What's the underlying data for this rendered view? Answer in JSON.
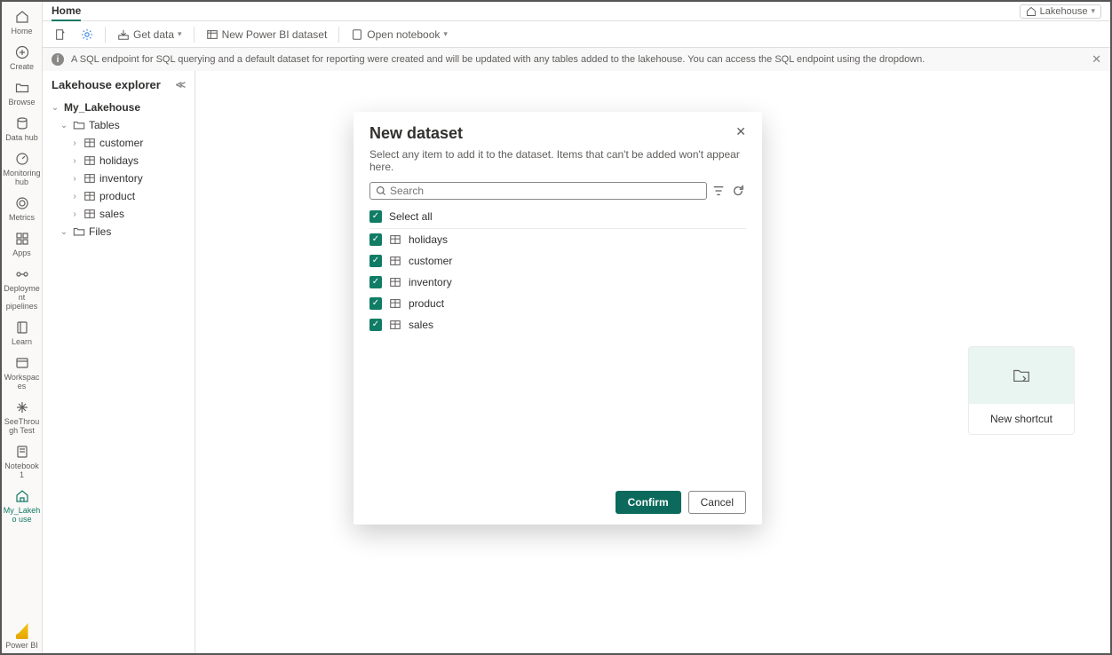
{
  "header": {
    "tab": "Home",
    "switcher": "Lakehouse"
  },
  "toolbar": {
    "get_data": "Get data",
    "new_dataset": "New Power BI dataset",
    "open_notebook": "Open notebook"
  },
  "banner": {
    "text": "A SQL endpoint for SQL querying and a default dataset for reporting were created and will be updated with any tables added to the lakehouse. You can access the SQL endpoint using the dropdown."
  },
  "rail": {
    "home": "Home",
    "create": "Create",
    "browse": "Browse",
    "datahub": "Data hub",
    "monitoring": "Monitoring hub",
    "metrics": "Metrics",
    "apps": "Apps",
    "pipelines": "Deployment pipelines",
    "learn": "Learn",
    "workspaces": "Workspaces",
    "seethrough": "SeeThrough Test",
    "notebook1": "Notebook 1",
    "mylakehouse": "My_Lakeho use",
    "powerbi": "Power BI"
  },
  "explorer": {
    "title": "Lakehouse explorer",
    "root": "My_Lakehouse",
    "tables_label": "Tables",
    "files_label": "Files",
    "tables": [
      "customer",
      "holidays",
      "inventory",
      "product",
      "sales"
    ]
  },
  "shortcut_card": {
    "label": "New shortcut"
  },
  "modal": {
    "title": "New dataset",
    "subtitle": "Select any item to add it to the dataset. Items that can't be added won't appear here.",
    "search_placeholder": "Search",
    "select_all": "Select all",
    "items": [
      "holidays",
      "customer",
      "inventory",
      "product",
      "sales"
    ],
    "confirm": "Confirm",
    "cancel": "Cancel"
  }
}
